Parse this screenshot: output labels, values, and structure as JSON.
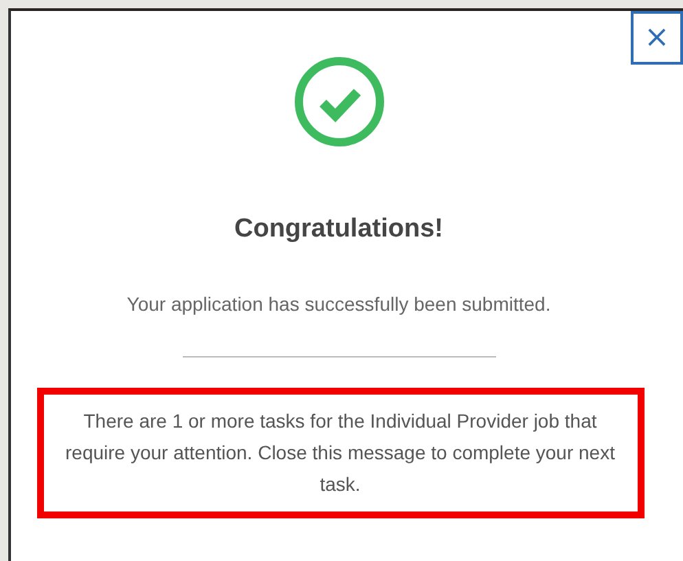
{
  "dialog": {
    "kind": "success",
    "title": "Congratulations!",
    "message": "Your application has successfully been submitted.",
    "close_button": "×",
    "notice": {
      "text": "There are 1 or more tasks for the Individual Provider job that require your attention. Close this message to complete your next task.",
      "highlighted": true
    }
  }
}
